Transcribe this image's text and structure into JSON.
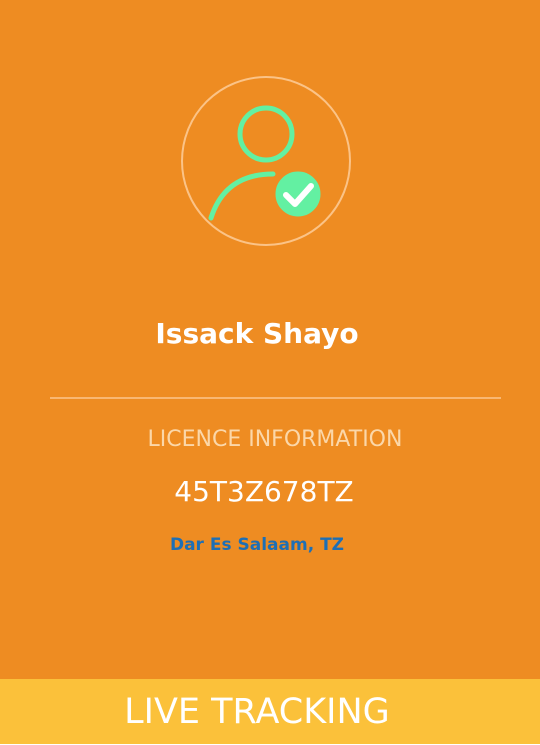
{
  "profile": {
    "avatar_icon": "verified-user-icon",
    "name": "Issack Shayo"
  },
  "licence": {
    "section_label": "LICENCE INFORMATION",
    "number": "45T3Z678TZ",
    "location": "Dar Es Salaam, TZ"
  },
  "footer": {
    "action_label": "LIVE TRACKING"
  },
  "colors": {
    "background": "#EE8C22",
    "footer_bar": "#FBC13A",
    "icon_accent": "#63F0A2",
    "location_text": "#1E6FB5"
  }
}
